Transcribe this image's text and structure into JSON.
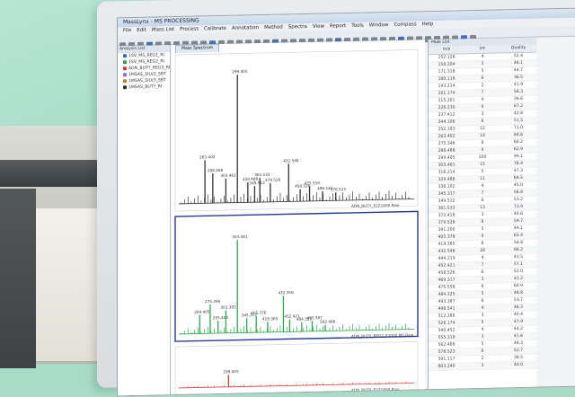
{
  "window": {
    "title": "MassLynx - MS PROCESSING",
    "menu": [
      "File",
      "Edit",
      "Mass List",
      "Process",
      "Calibrate",
      "Annotation",
      "Method",
      "Spectra",
      "View",
      "Report",
      "Tools",
      "Window",
      "Compass",
      "Help"
    ]
  },
  "tree": {
    "header": "Analysis List",
    "items": [
      {
        "label": "1SV_MS_REG1_RI",
        "color": "#2e6cc0"
      },
      {
        "label": "1SV_MS_REG2_RI",
        "color": "#2aa34a"
      },
      {
        "label": "ADN_BUTY_REG3_RI",
        "color": "#c43b3b"
      },
      {
        "label": "1MSAS_SILV2_SBT",
        "color": "#8a6ac2"
      },
      {
        "label": "1MSAS_SILV3_SBT",
        "color": "#c07a2b"
      },
      {
        "label": "1MSAS_BUTY_RI",
        "color": "#2f2f2f"
      }
    ]
  },
  "spectra": {
    "tab_label": "Mass Spectrum",
    "panels": [
      {
        "label": "ADN_BUTY_E2Z1800 Raw",
        "color": "#333333",
        "peaks": [
          {
            "mz": 200,
            "h": 0.32,
            "lab": "263.402"
          },
          {
            "mz": 215,
            "h": 0.22,
            "lab": "288.488"
          },
          {
            "mz": 240,
            "h": 0.18,
            "lab": "303.461"
          },
          {
            "mz": 262,
            "h": 0.95,
            "lab": "299.405"
          },
          {
            "mz": 282,
            "h": 0.15,
            "lab": "329.488"
          },
          {
            "mz": 295,
            "h": 0.12,
            "lab": "349.512"
          },
          {
            "mz": 305,
            "h": 0.18,
            "lab": "361.533"
          },
          {
            "mz": 325,
            "h": 0.14,
            "lab": "379.528"
          },
          {
            "mz": 360,
            "h": 0.28,
            "lab": "432.546"
          },
          {
            "mz": 382,
            "h": 0.09,
            "lab": "458.526"
          },
          {
            "mz": 400,
            "h": 0.11,
            "lab": "475.558"
          },
          {
            "mz": 425,
            "h": 0.07,
            "lab": "498.541"
          },
          {
            "mz": 450,
            "h": 0.06,
            "lab": "578.523"
          }
        ]
      },
      {
        "label": "ADN_BUTY_REG2_E2000 MS Raw",
        "color": "#2ea84e",
        "peaks": [
          {
            "mz": 190,
            "h": 0.18,
            "lab": "264.405"
          },
          {
            "mz": 210,
            "h": 0.28,
            "lab": "275.346"
          },
          {
            "mz": 225,
            "h": 0.12,
            "lab": "293.403"
          },
          {
            "mz": 240,
            "h": 0.22,
            "lab": "301.383"
          },
          {
            "mz": 262,
            "h": 0.9,
            "lab": "303.381"
          },
          {
            "mz": 280,
            "h": 0.14,
            "lab": "345.317"
          },
          {
            "mz": 298,
            "h": 0.16,
            "lab": "405.376"
          },
          {
            "mz": 320,
            "h": 0.1,
            "lab": "419.365"
          },
          {
            "mz": 350,
            "h": 0.35,
            "lab": "432.356"
          },
          {
            "mz": 362,
            "h": 0.12,
            "lab": "452.421"
          },
          {
            "mz": 385,
            "h": 0.09,
            "lab": "484.325"
          },
          {
            "mz": 405,
            "h": 0.1,
            "lab": "493.387"
          },
          {
            "mz": 430,
            "h": 0.06,
            "lab": "562.486"
          }
        ]
      },
      {
        "label": "ADN_BUTY_E2Z1800 Raw",
        "color": "#d23b3b",
        "peaks": [
          {
            "mz": 245,
            "h": 0.45,
            "lab": "299.405"
          }
        ]
      }
    ]
  },
  "peaklist": {
    "header": "Peak List",
    "columns": [
      "m/z",
      "Int",
      "Quality"
    ],
    "rows": [
      [
        "152.126",
        "4",
        "52.4"
      ],
      [
        "158.204",
        "3",
        "48.1"
      ],
      [
        "171.318",
        "5",
        "44.7"
      ],
      [
        "180.118",
        "6",
        "36.5"
      ],
      [
        "193.214",
        "2",
        "41.9"
      ],
      [
        "201.174",
        "7",
        "58.3"
      ],
      [
        "215.201",
        "4",
        "39.6"
      ],
      [
        "226.230",
        "9",
        "67.2"
      ],
      [
        "237.412",
        "3",
        "42.8"
      ],
      [
        "244.108",
        "6",
        "51.5"
      ],
      [
        "252.183",
        "12",
        "71.0"
      ],
      [
        "263.402",
        "18",
        "84.6"
      ],
      [
        "275.346",
        "8",
        "60.2"
      ],
      [
        "288.488",
        "9",
        "62.9"
      ],
      [
        "299.405",
        "100",
        "99.1"
      ],
      [
        "303.461",
        "15",
        "78.4"
      ],
      [
        "316.214",
        "5",
        "47.3"
      ],
      [
        "329.488",
        "11",
        "69.5"
      ],
      [
        "336.102",
        "4",
        "45.0"
      ],
      [
        "345.317",
        "7",
        "56.8"
      ],
      [
        "349.512",
        "6",
        "53.2"
      ],
      [
        "361.533",
        "13",
        "73.9"
      ],
      [
        "372.418",
        "3",
        "40.6"
      ],
      [
        "379.528",
        "8",
        "59.7"
      ],
      [
        "391.200",
        "5",
        "49.1"
      ],
      [
        "405.376",
        "9",
        "63.4"
      ],
      [
        "419.365",
        "6",
        "54.8"
      ],
      [
        "432.546",
        "28",
        "88.2"
      ],
      [
        "444.219",
        "4",
        "43.5"
      ],
      [
        "452.421",
        "7",
        "57.1"
      ],
      [
        "458.526",
        "6",
        "52.0"
      ],
      [
        "469.317",
        "3",
        "41.2"
      ],
      [
        "475.558",
        "8",
        "60.9"
      ],
      [
        "484.325",
        "5",
        "48.8"
      ],
      [
        "493.387",
        "6",
        "53.7"
      ],
      [
        "498.541",
        "4",
        "46.3"
      ],
      [
        "512.288",
        "3",
        "40.4"
      ],
      [
        "526.174",
        "5",
        "47.9"
      ],
      [
        "540.452",
        "4",
        "44.2"
      ],
      [
        "555.319",
        "3",
        "41.6"
      ],
      [
        "562.486",
        "5",
        "48.3"
      ],
      [
        "578.523",
        "6",
        "52.7"
      ],
      [
        "591.117",
        "2",
        "38.5"
      ],
      [
        "603.240",
        "3",
        "40.0"
      ]
    ]
  }
}
